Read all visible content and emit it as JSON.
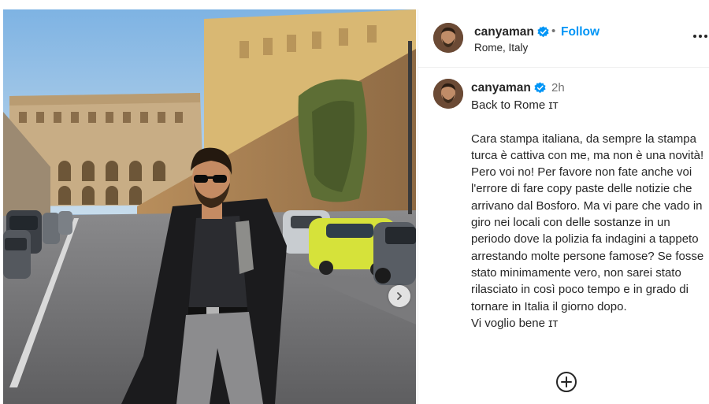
{
  "post": {
    "username": "canyaman",
    "verified": true,
    "follow_label": "Follow",
    "separator": "•",
    "location": "Rome, Italy",
    "time_ago": "2h",
    "caption_first": "Back to Rome ɪᴛ",
    "caption_body": "Cara stampa italiana, da sempre la stampa turca è cattiva con me, ma non è una novità! Pero voi no! Per favore non fate anche voi l'errore di fare copy paste delle notizie che arrivano dal Bosforo. Ma vi pare che vado in giro nei locali con delle sostanze in un periodo dove la polizia fa indagini a tappeto arrestando molte persone famose? Se fosse stato minimamente vero, non sarei stato rilasciato in così poco tempo e in grado di tornare in Italia il giorno dopo.",
    "caption_last": "Vi voglio bene ɪᴛ"
  },
  "icons": {
    "verified": "verified-badge-icon",
    "more": "more-options-icon",
    "next": "chevron-right-icon",
    "add": "add-circle-icon"
  },
  "colors": {
    "follow_blue": "#0095f6",
    "verified_blue": "#0095f6",
    "text": "#262626",
    "muted": "#737373",
    "border": "#efefef"
  }
}
